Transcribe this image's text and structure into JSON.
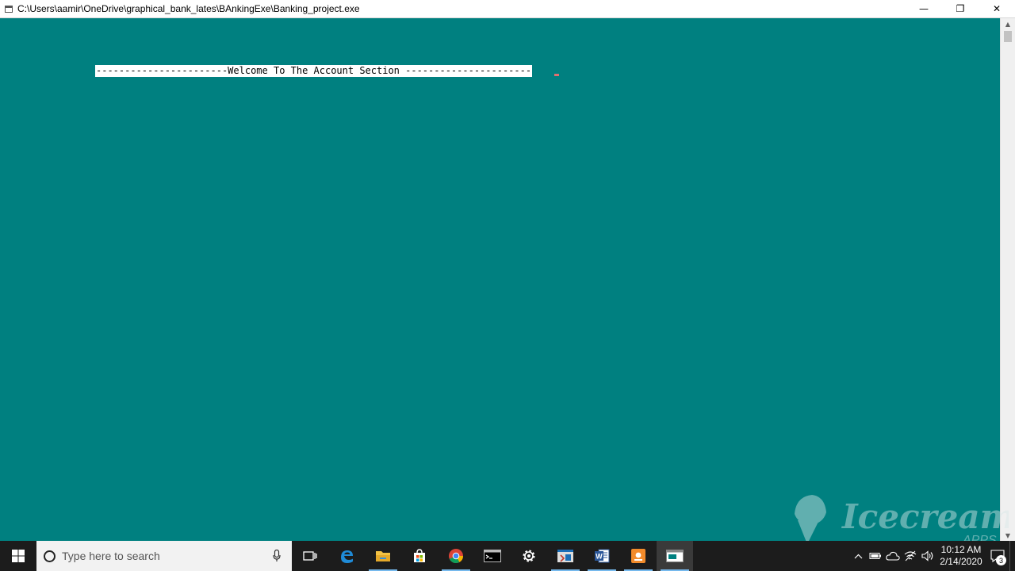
{
  "window": {
    "title": "C:\\Users\\aamir\\OneDrive\\graphical_bank_lates\\BAnkingExe\\Banking_project.exe",
    "minimize_glyph": "—",
    "restore_glyph": "❐",
    "close_glyph": "✕"
  },
  "console": {
    "welcome_text": "-----------------------Welcome To The Account Section ----------------------",
    "background_color": "#008080",
    "text_highlight_color": "#ffffff"
  },
  "watermark": {
    "brand": "Icecream",
    "sub": "APPS"
  },
  "taskbar": {
    "search_placeholder": "Type here to search",
    "pinned_icons": [
      "task-view-icon",
      "edge-icon",
      "file-explorer-icon",
      "store-icon",
      "chrome-icon",
      "terminal-icon",
      "settings-icon",
      "code-editor-icon",
      "word-icon",
      "recorder-icon",
      "console-app-icon"
    ],
    "tray_icons": [
      "chevron-up-icon",
      "battery-icon",
      "onedrive-icon",
      "wifi-icon",
      "volume-icon"
    ],
    "clock_time": "10:12 AM",
    "clock_date": "2/14/2020",
    "notification_count": "3"
  }
}
